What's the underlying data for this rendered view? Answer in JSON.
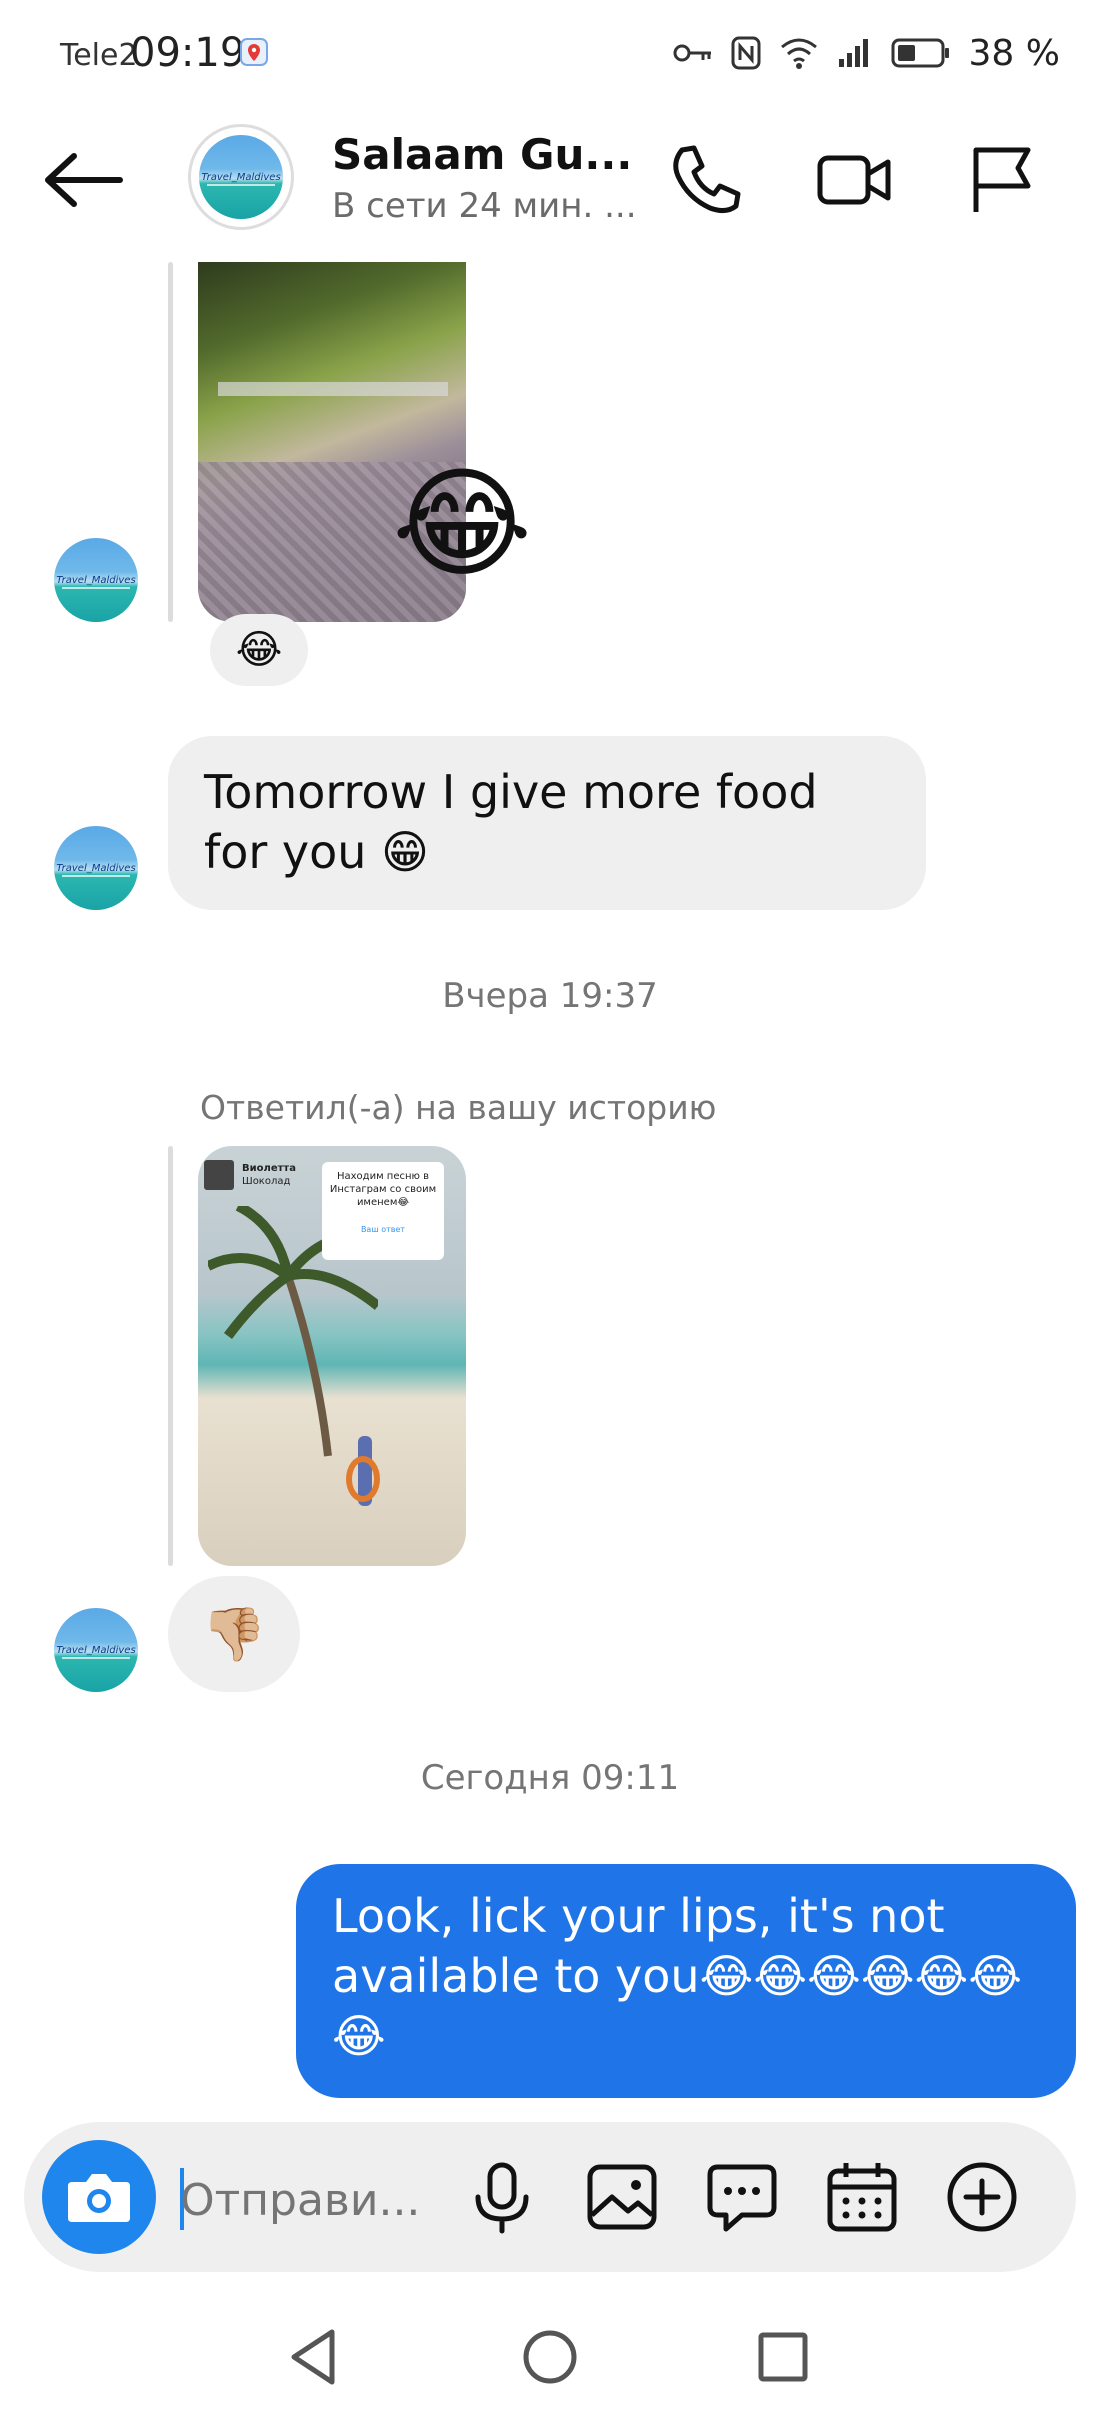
{
  "status_bar": {
    "carrier": "Tele2",
    "time": "09:19",
    "battery": "38 %"
  },
  "header": {
    "title": "Salaam Gu...",
    "subtitle": "В сети 24 мин. ...",
    "avatar_caption": "Travel_Maldives"
  },
  "messages": {
    "reaction_1": "😂",
    "photo_1_emoji": "😂",
    "incoming_text": "Tomorrow I give more food for you 😁",
    "timestamp_1": "Вчера 19:37",
    "reply_label": "Ответил(-а) на вашу историю",
    "story": {
      "user_name": "Виолетта",
      "user_sub": "Шоколад",
      "card_text": "Находим песню в Инстаграм со своим именем😂",
      "card_answer": "Ваш ответ"
    },
    "reaction_2": "👎🏼",
    "timestamp_2": "Сегодня 09:11",
    "outgoing_text": "Look, lick your lips, it's not available to you😂😂😂😂😂😂😂"
  },
  "composer": {
    "placeholder": "Отправи..."
  },
  "colors": {
    "accent": "#1f74e8",
    "bubble_in": "#efefef",
    "meta_text": "#757575"
  }
}
